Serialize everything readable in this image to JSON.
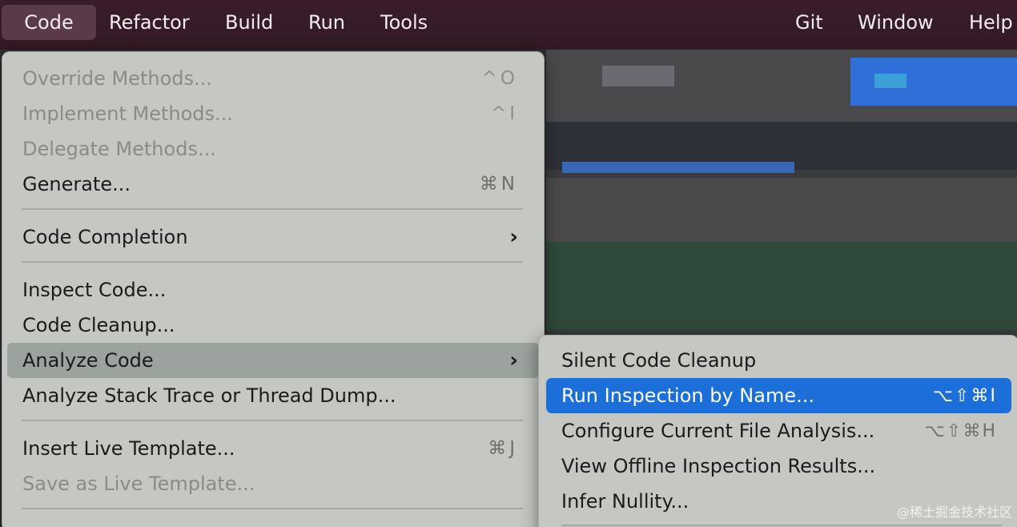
{
  "menubar": {
    "items": [
      "Code",
      "Refactor",
      "Build",
      "Run",
      "Tools",
      "Git",
      "Window",
      "Help"
    ],
    "active": "Code"
  },
  "code_menu": {
    "items": [
      {
        "label": "Override Methods...",
        "shortcut": "^O",
        "enabled": false
      },
      {
        "label": "Implement Methods...",
        "shortcut": "^I",
        "enabled": false
      },
      {
        "label": "Delegate Methods...",
        "shortcut": "",
        "enabled": false
      },
      {
        "label": "Generate...",
        "shortcut": "⌘N",
        "enabled": true
      },
      {
        "label": "Code Completion",
        "submenu": true,
        "enabled": true
      },
      {
        "label": "Inspect Code...",
        "enabled": true
      },
      {
        "label": "Code Cleanup...",
        "enabled": true
      },
      {
        "label": "Analyze Code",
        "submenu": true,
        "enabled": true,
        "highlighted": true
      },
      {
        "label": "Analyze Stack Trace or Thread Dump...",
        "enabled": true
      },
      {
        "label": "Insert Live Template...",
        "shortcut": "⌘J",
        "enabled": true
      },
      {
        "label": "Save as Live Template...",
        "enabled": false
      }
    ]
  },
  "analyze_submenu": {
    "items": [
      {
        "label": "Silent Code Cleanup",
        "shortcut": ""
      },
      {
        "label": "Run Inspection by Name...",
        "shortcut": "⌥⇧⌘I",
        "selected": true
      },
      {
        "label": "Configure Current File Analysis...",
        "shortcut": "⌥⇧⌘H"
      },
      {
        "label": "View Offline Inspection Results...",
        "shortcut": ""
      },
      {
        "label": "Infer Nullity...",
        "shortcut": ""
      }
    ]
  },
  "icons": {
    "submenu_arrow": "chevron-right-icon"
  },
  "colors": {
    "selection": "#1c6fd9",
    "menubar": "#341b27",
    "menu_bg": "#c4c7c2"
  },
  "watermark": "@稀土掘金技术社区"
}
